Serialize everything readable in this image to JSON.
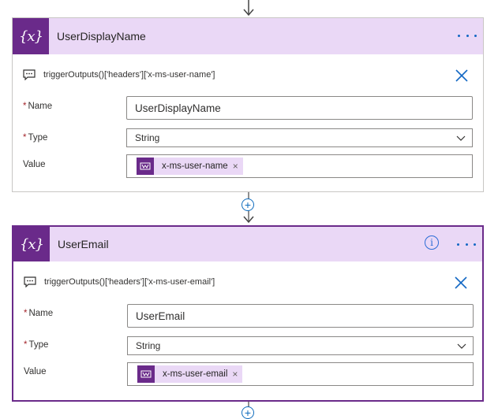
{
  "card1": {
    "title": "UserDisplayName",
    "expression": "triggerOutputs()['headers']['x-ms-user-name']",
    "name_label": "Name",
    "type_label": "Type",
    "value_label": "Value",
    "name_value": "UserDisplayName",
    "type_value": "String",
    "token_label": "x-ms-user-name"
  },
  "card2": {
    "title": "UserEmail",
    "expression": "triggerOutputs()['headers']['x-ms-user-email']",
    "name_label": "Name",
    "type_label": "Type",
    "value_label": "Value",
    "name_value": "UserEmail",
    "type_value": "String",
    "token_label": "x-ms-user-email"
  },
  "icons": {
    "variable": "{x}",
    "info": "i",
    "token_remove": "×",
    "add": "+"
  },
  "colors": {
    "accent": "#6a2a8a",
    "header_bg": "#ead8f6",
    "link_blue": "#1368c4"
  }
}
